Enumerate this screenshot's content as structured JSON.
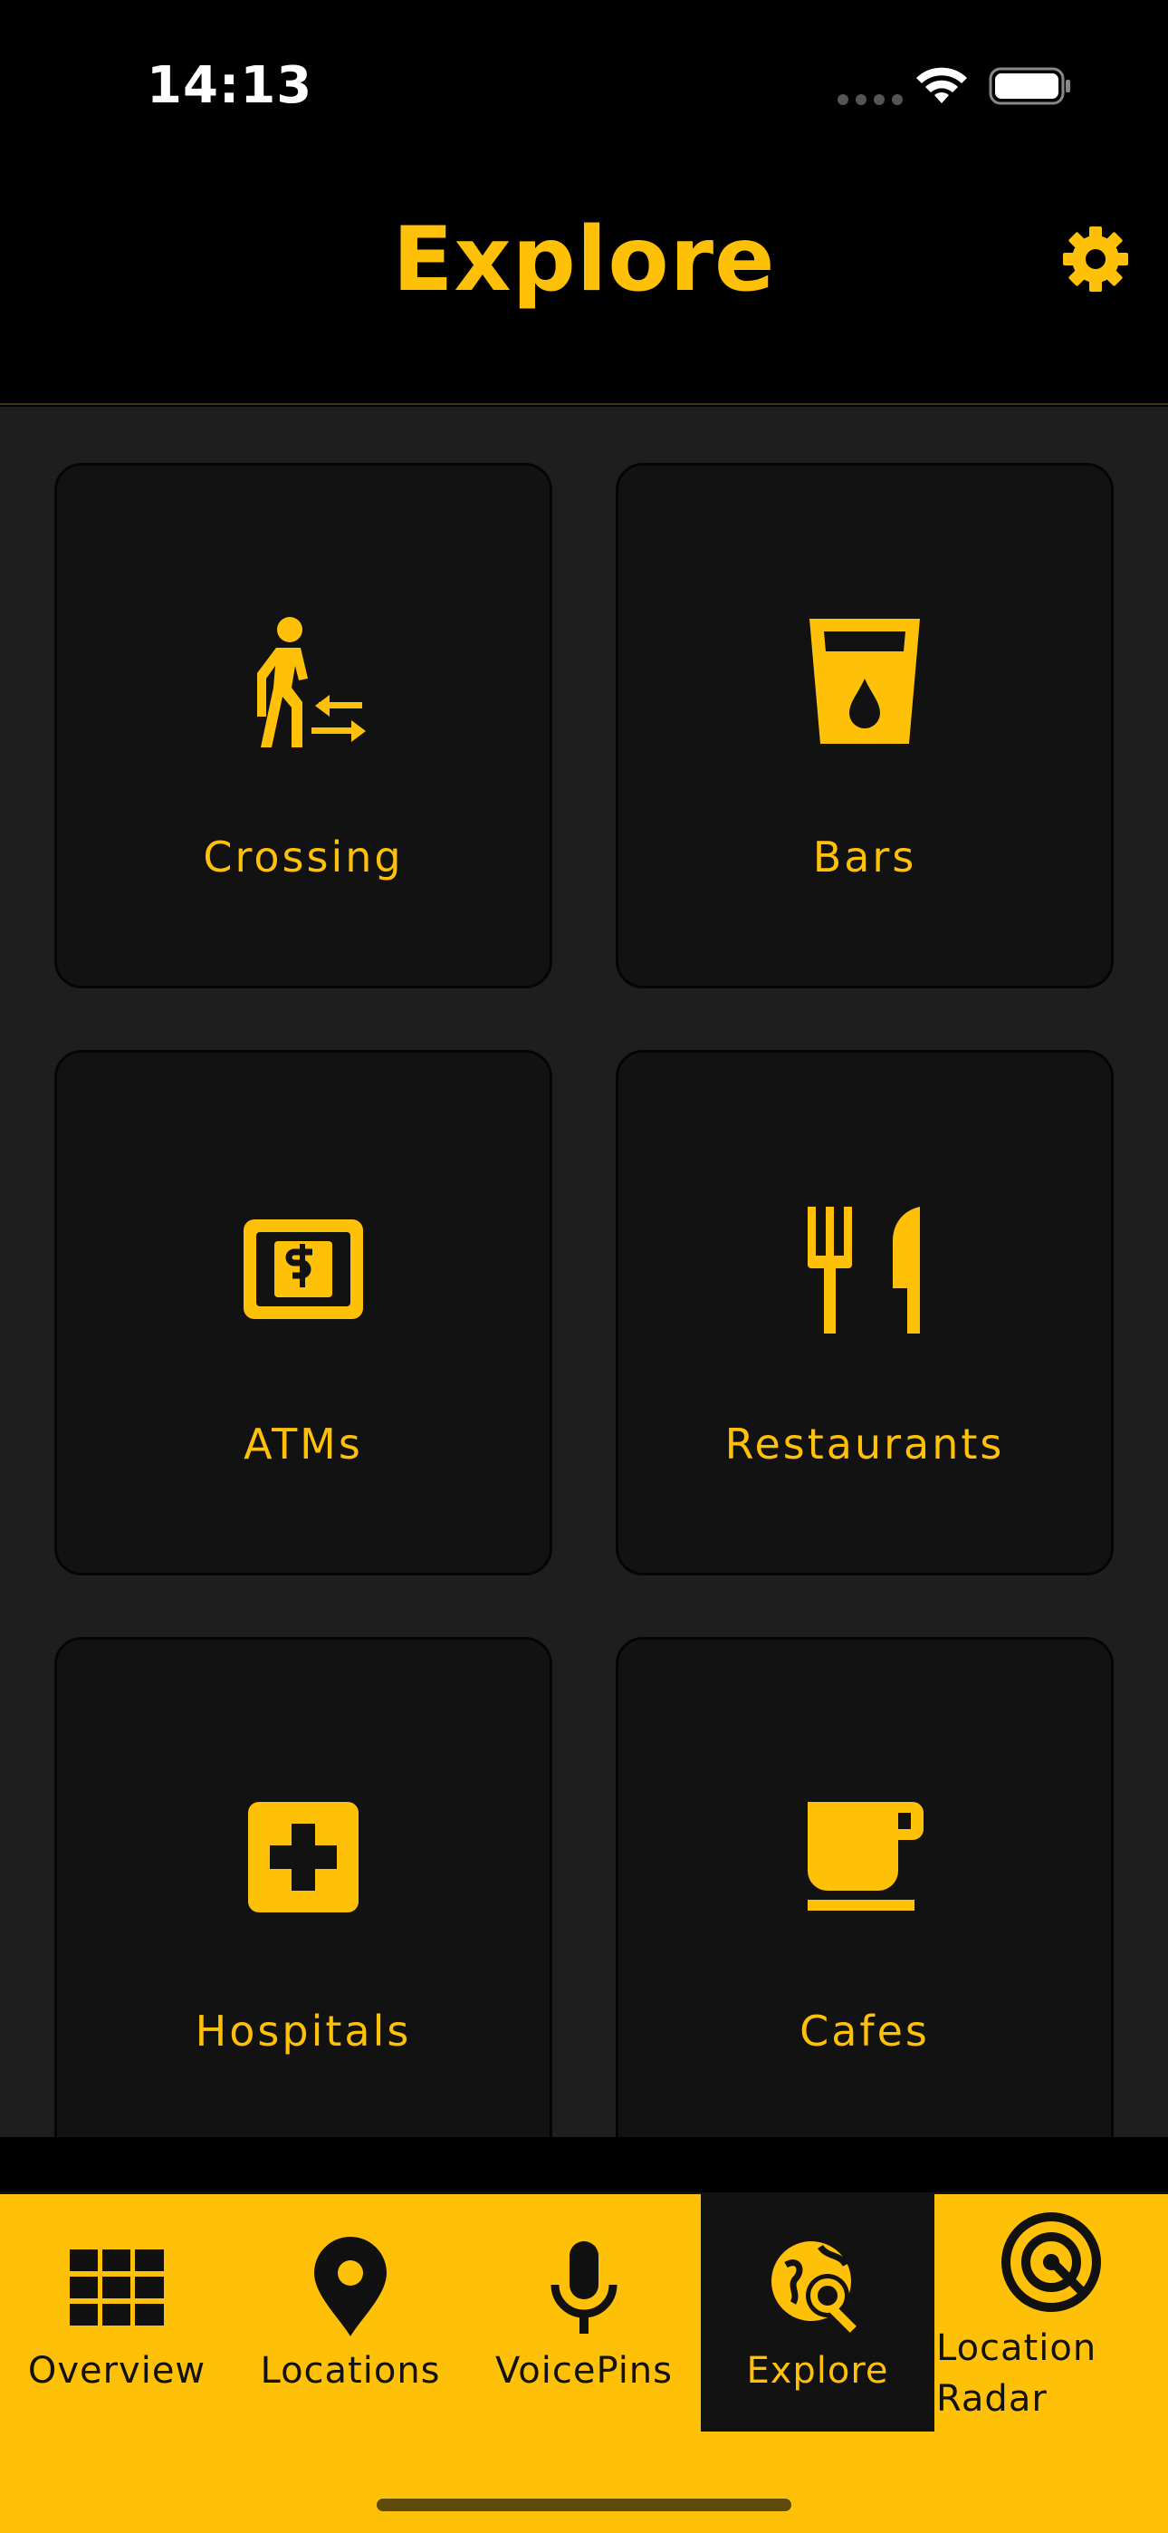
{
  "status": {
    "time": "14:13"
  },
  "header": {
    "title": "Explore"
  },
  "categories": [
    {
      "label": "Crossing",
      "icon": "pedestrian-crossing-icon"
    },
    {
      "label": "Bars",
      "icon": "drink-glass-icon"
    },
    {
      "label": "ATMs",
      "icon": "atm-money-icon"
    },
    {
      "label": "Restaurants",
      "icon": "fork-knife-icon"
    },
    {
      "label": "Hospitals",
      "icon": "medical-cross-icon"
    },
    {
      "label": "Cafes",
      "icon": "coffee-cup-icon"
    }
  ],
  "tabs": [
    {
      "label": "Overview",
      "icon": "grid-icon",
      "active": false
    },
    {
      "label": "Locations",
      "icon": "map-pin-icon",
      "active": false
    },
    {
      "label": "VoicePins",
      "icon": "microphone-icon",
      "active": false
    },
    {
      "label": "Explore",
      "icon": "explore-globe-search-icon",
      "active": true
    },
    {
      "label": "Location Radar",
      "icon": "radar-icon",
      "active": false
    }
  ],
  "colors": {
    "accent": "#FFC107",
    "background": "#1e1e1e",
    "tile": "#121212",
    "header": "#000000"
  }
}
